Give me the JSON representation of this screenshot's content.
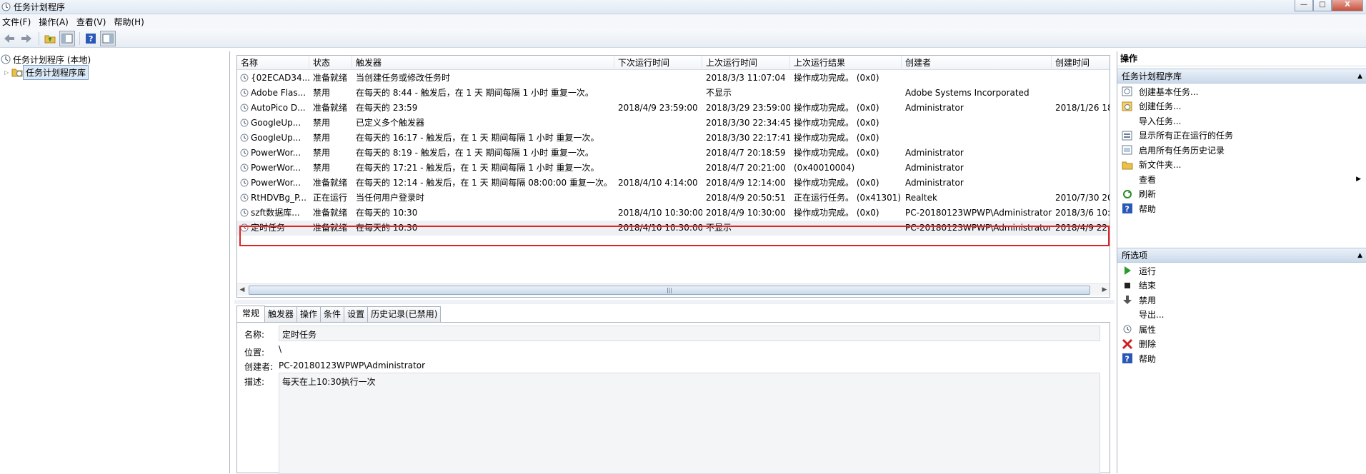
{
  "window": {
    "title": "任务计划程序",
    "min": "—",
    "max": "□",
    "close": "X"
  },
  "menu": [
    "文件(F)",
    "操作(A)",
    "查看(V)",
    "帮助(H)"
  ],
  "tree": {
    "root": "任务计划程序 (本地)",
    "child": "任务计划程序库"
  },
  "grid": {
    "columns": [
      "名称",
      "状态",
      "触发器",
      "下次运行时间",
      "上次运行时间",
      "上次运行结果",
      "创建者",
      "创建时间"
    ],
    "rows": [
      [
        "{02ECAD34...",
        "准备就绪",
        "当创建任务或修改任务时",
        "",
        "2018/3/3 11:07:04",
        "操作成功完成。 (0x0)",
        "",
        ""
      ],
      [
        "Adobe Flas...",
        "禁用",
        "在每天的 8:44 - 触发后，在 1 天 期间每隔 1 小时 重复一次。",
        "",
        "不显示",
        "",
        "Adobe Systems Incorporated",
        ""
      ],
      [
        "AutoPico D...",
        "准备就绪",
        "在每天的 23:59",
        "2018/4/9 23:59:00",
        "2018/3/29 23:59:00",
        "操作成功完成。 (0x0)",
        "Administrator",
        "2018/1/26 18:"
      ],
      [
        "GoogleUp...",
        "禁用",
        "已定义多个触发器",
        "",
        "2018/3/30 22:34:45",
        "操作成功完成。 (0x0)",
        "",
        ""
      ],
      [
        "GoogleUp...",
        "禁用",
        "在每天的 16:17 - 触发后，在 1 天 期间每隔 1 小时 重复一次。",
        "",
        "2018/3/30 22:17:41",
        "操作成功完成。 (0x0)",
        "",
        ""
      ],
      [
        "PowerWor...",
        "禁用",
        "在每天的 8:19 - 触发后，在 1 天 期间每隔 1 小时 重复一次。",
        "",
        "2018/4/7 20:18:59",
        "操作成功完成。 (0x0)",
        "Administrator",
        ""
      ],
      [
        "PowerWor...",
        "禁用",
        "在每天的 17:21 - 触发后，在 1 天 期间每隔 1 小时 重复一次。",
        "",
        "2018/4/7 20:21:00",
        "(0x40010004)",
        "Administrator",
        ""
      ],
      [
        "PowerWor...",
        "准备就绪",
        "在每天的 12:14 - 触发后，在 1 天 期间每隔 08:00:00 重复一次。",
        "2018/4/10 4:14:00",
        "2018/4/9 12:14:00",
        "操作成功完成。 (0x0)",
        "Administrator",
        ""
      ],
      [
        "RtHDVBg_P...",
        "正在运行",
        "当任何用户登录时",
        "",
        "2018/4/9 20:50:51",
        "正在运行任务。 (0x41301)",
        "Realtek",
        "2010/7/30 20:"
      ],
      [
        "szft数据库...",
        "准备就绪",
        "在每天的 10:30",
        "2018/4/10 10:30:00",
        "2018/4/9 10:30:00",
        "操作成功完成。 (0x0)",
        "PC-20180123WPWP\\Administrator",
        "2018/3/6 10:3"
      ],
      [
        "定时任务",
        "准备就绪",
        "在每天的 10:30",
        "2018/4/10 10:30:00",
        "不显示",
        "",
        "PC-20180123WPWP\\Administrator",
        "2018/4/9 22:5"
      ]
    ],
    "scroll_grip": "|||"
  },
  "tabs": [
    "常规",
    "触发器",
    "操作",
    "条件",
    "设置",
    "历史记录(已禁用)"
  ],
  "detail": {
    "name_label": "名称:",
    "name_value": "定时任务",
    "location_label": "位置:",
    "location_value": "\\",
    "author_label": "创建者:",
    "author_value": "PC-20180123WPWP\\Administrator",
    "desc_label": "描述:",
    "desc_value": "每天在上10:30执行一次"
  },
  "actions": {
    "title": "操作",
    "section1": "任务计划程序库",
    "items1": [
      "创建基本任务...",
      "创建任务...",
      "导入任务...",
      "显示所有正在运行的任务",
      "启用所有任务历史记录",
      "新文件夹...",
      "查看",
      "刷新",
      "帮助"
    ],
    "section2": "所选项",
    "items2": [
      "运行",
      "结束",
      "禁用",
      "导出...",
      "属性",
      "删除",
      "帮助"
    ]
  }
}
